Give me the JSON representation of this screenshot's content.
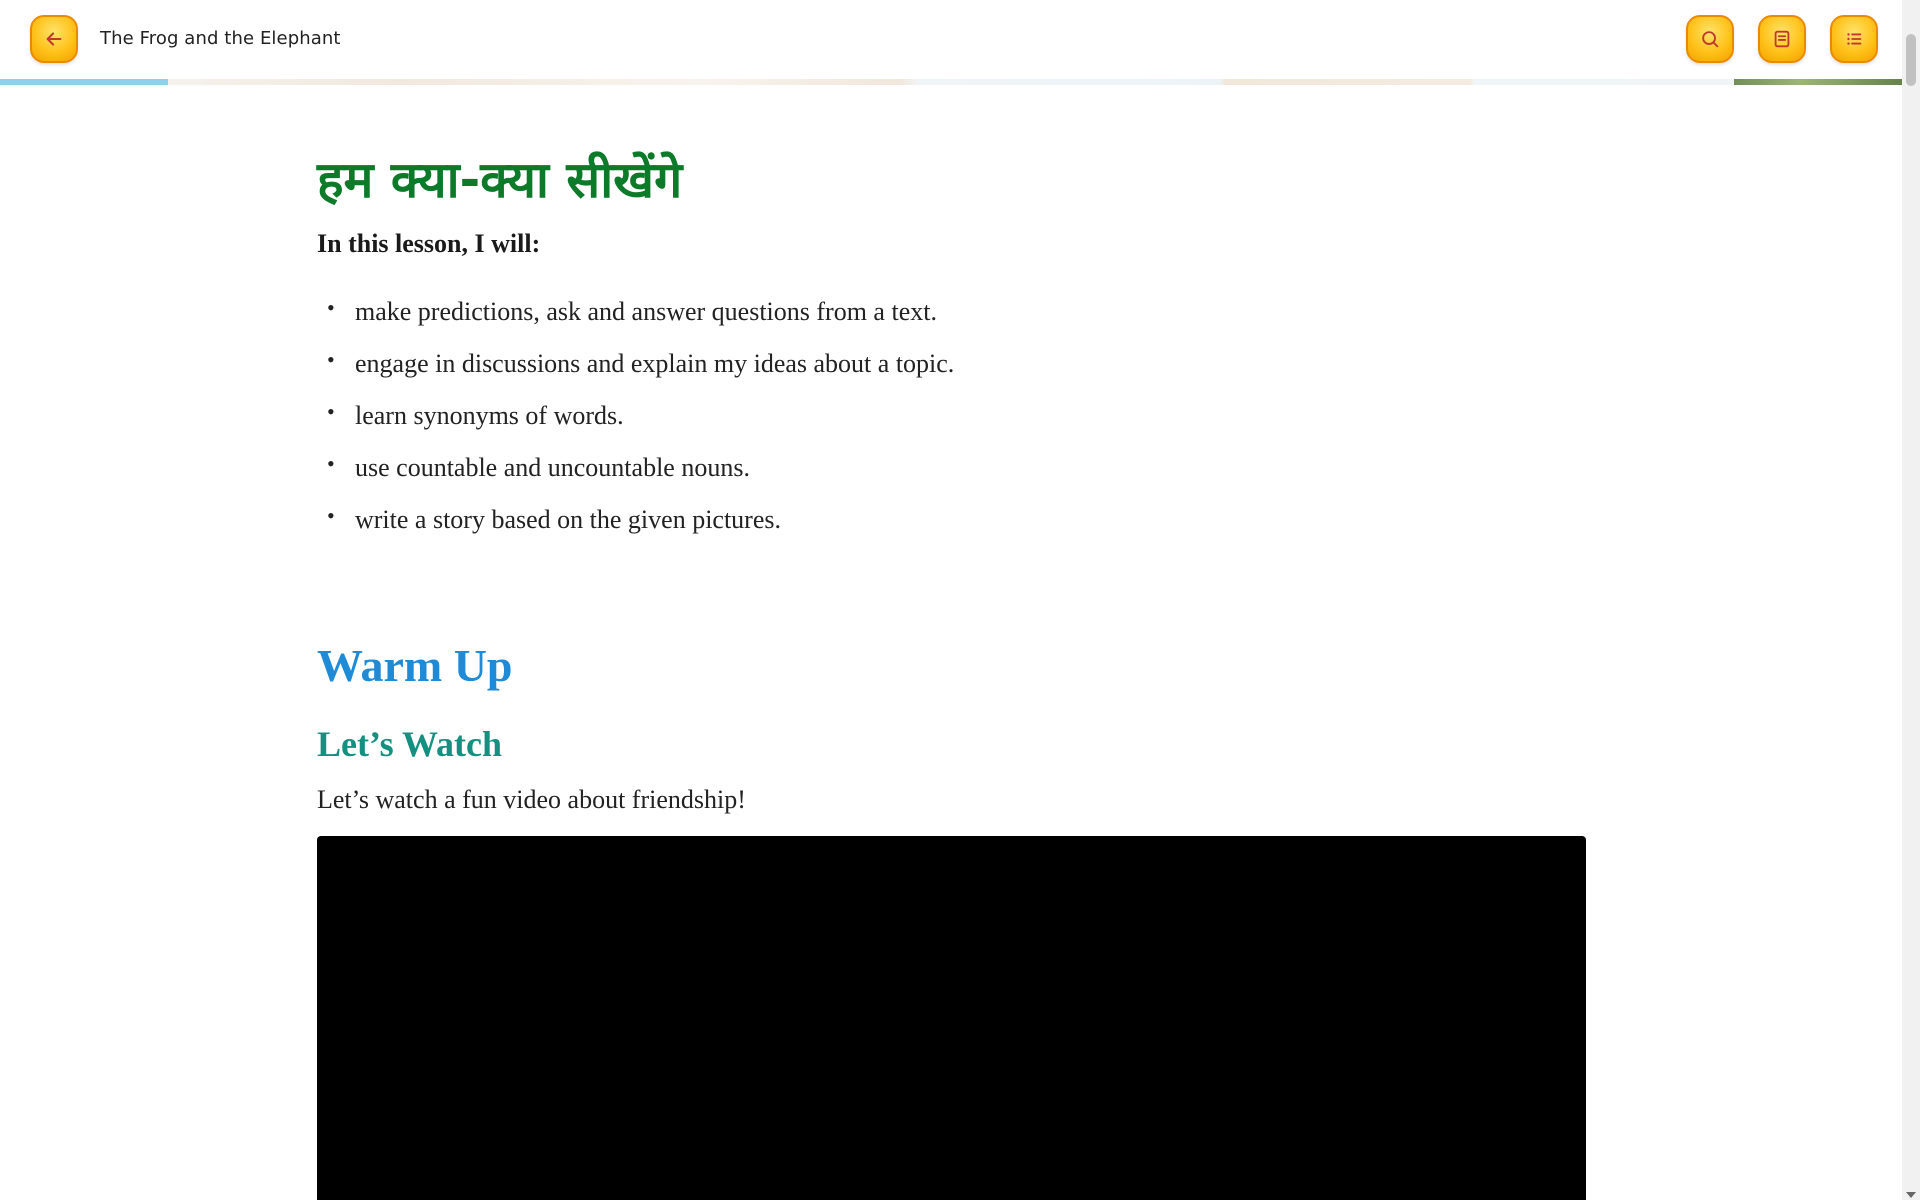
{
  "header": {
    "title": "The Frog and the Elephant",
    "back_icon": "arrow-left-icon",
    "search_icon": "search-icon",
    "notes_icon": "notes-icon",
    "menu_icon": "list-menu-icon",
    "accent_color": "#ffc21a"
  },
  "objectives": {
    "hindi_title": "हम क्या-क्या सीखेंगे",
    "intro": "In this lesson, I will:",
    "items": [
      "make predictions, ask and answer questions from a text.",
      "engage in discussions and explain my ideas about a topic.",
      "learn synonyms of words.",
      "use countable and uncountable nouns.",
      "write a story based on the given pictures."
    ]
  },
  "warm_up": {
    "heading": "Warm Up",
    "subheading": "Let’s Watch",
    "description": "Let’s watch a fun video about friendship!"
  },
  "colors": {
    "hindi_title": "#0d7a2a",
    "warm_up": "#1f8ad6",
    "lets_watch": "#159080"
  }
}
